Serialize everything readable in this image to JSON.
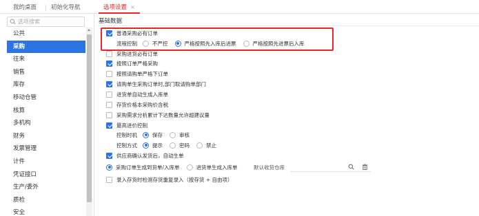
{
  "tabs": [
    {
      "label": "我的桌面"
    },
    {
      "label": "初始化导航"
    },
    {
      "label": "选项设置",
      "close": "×"
    }
  ],
  "sidebar": {
    "search_placeholder": "选项搜索",
    "items": [
      {
        "label": "公共"
      },
      {
        "label": "采购",
        "active": true
      },
      {
        "label": "往来"
      },
      {
        "label": "销售"
      },
      {
        "label": "库存"
      },
      {
        "label": "移动仓管"
      },
      {
        "label": "核算"
      },
      {
        "label": "多机构"
      },
      {
        "label": "财务"
      },
      {
        "label": "发票管理"
      },
      {
        "label": "计件"
      },
      {
        "label": "凭证接口"
      },
      {
        "label": "生产/委外"
      },
      {
        "label": "质检"
      },
      {
        "label": "安全"
      }
    ]
  },
  "main": {
    "section_title": "基础数据",
    "options": {
      "o1": {
        "label": "普通采购必有订单",
        "checked": true
      },
      "flow": {
        "label": "流程控制",
        "r1": "不严控",
        "r2": "严格按照先入库后进票",
        "r3": "严格按照先进票后入库",
        "selected": 2
      },
      "o2": {
        "label": "采购进货必有订单",
        "checked": false
      },
      "o3": {
        "label": "按照订单严格采购",
        "checked": true
      },
      "o4": {
        "label": "按照请购单严格下订单",
        "checked": false
      },
      "o5": {
        "label": "请购单生采购订单时,部门取请购单部门",
        "checked": true
      },
      "o6": {
        "label": "进货单自动生成入库单",
        "checked": false
      },
      "o7": {
        "label": "存货价格本采购价含税",
        "checked": false
      },
      "o8": {
        "label": "采购需求分析累计下达数量允许超建议量",
        "checked": false
      },
      "o9": {
        "label": "最高进价控制",
        "checked": true
      },
      "timing": {
        "label": "控制时机",
        "r1": "保存",
        "r2": "审核",
        "selected": 1
      },
      "method": {
        "label": "控制方式",
        "r1": "提示",
        "r2": "密码",
        "r3": "禁止",
        "selected": 1
      },
      "o10": {
        "label": "供应商确认发货后，自动生单",
        "checked": true
      },
      "gen": {
        "r1": "采购订单生成到货单/入库单",
        "r2": "进货单生成入库单",
        "selected": 1
      },
      "warehouse_label": "默认收货仓库",
      "o11": {
        "label": "录入存货时检测存货重复录入（按存货 + 自由项）",
        "checked": false
      }
    }
  },
  "colors": {
    "accent": "#2b74e2",
    "highlight": "#e5252a",
    "tab_active": "#e5252a"
  }
}
